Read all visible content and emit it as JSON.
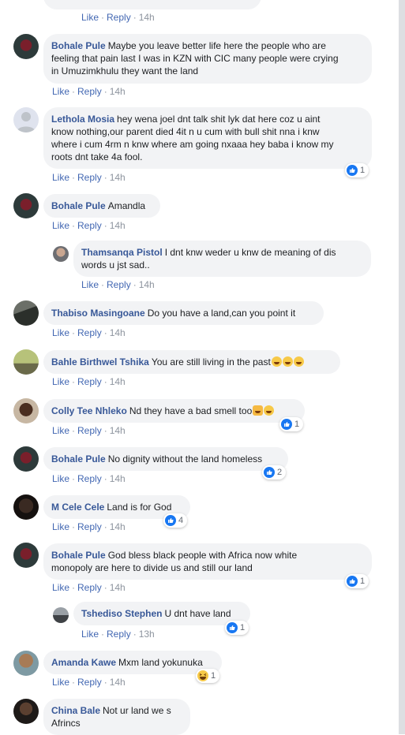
{
  "actions": {
    "like": "Like",
    "reply": "Reply",
    "sep": "·"
  },
  "top": {
    "time": "14h"
  },
  "comments": [
    {
      "name": "Bohale Pule",
      "text_line1": "Maybe you leave better life here the people who are",
      "text_line2": "feeling that pain last I was in KZN with CIC many people were crying",
      "text_line3": "in Umuzimkhulu they want the land",
      "time": "14h"
    },
    {
      "name": "Lethola Mosia",
      "text_line1": "hey wena joel dnt talk shit lyk dat here coz u aint",
      "text_line2": "know nothing,our parent died 4it n u cum with bull shit nna i knw",
      "text_line3": "where i cum 4rm n knw where am going nxaaa hey baba i know my",
      "text_line4": "roots dnt take 4a fool.",
      "time": "14h",
      "reaction_count": "1"
    },
    {
      "name": "Bohale Pule",
      "text": "Amandla",
      "time": "14h"
    },
    {
      "name": "Thamsanqa Pistol",
      "text_line1": "I dnt knw weder u knw de meaning of dis",
      "text_line2": "words u jst sad..",
      "time": "14h"
    },
    {
      "name": "Thabiso Masingoane",
      "text": "Do you have a land,can you point it",
      "time": "14h"
    },
    {
      "name": "Bahle Birthwel Tshika",
      "text": "You are still living in the past",
      "time": "14h"
    },
    {
      "name": "Colly Tee Nhleko",
      "text": "Nd they have a bad smell too",
      "time": "14h",
      "reaction_count": "1"
    },
    {
      "name": "Bohale Pule",
      "text": "No dignity without the land homeless",
      "time": "14h",
      "reaction_count": "2"
    },
    {
      "name": "M Cele Cele",
      "text": "Land is for God",
      "time": "14h",
      "reaction_count": "4"
    },
    {
      "name": "Bohale Pule",
      "text_line1": "God bless black people with Africa now white",
      "text_line2": "monopoly are here to divide us and still our land",
      "time": "14h",
      "reaction_count": "1"
    },
    {
      "name": "Tshediso Stephen",
      "text": "U dnt have land",
      "time": "13h",
      "reaction_count": "1"
    },
    {
      "name": "Amanda Kawe",
      "text": "Mxm land yokunuka",
      "time": "14h",
      "reaction_count": "1"
    },
    {
      "name": "China Bale",
      "text_line1": "Not ur land we s",
      "text_line2": "Afrincs"
    }
  ],
  "colors": {
    "link": "#385898",
    "action": "#4267b2",
    "bubble": "#f2f3f5",
    "like": "#1877f2"
  },
  "icons": {
    "like": "like-icon",
    "haha": "haha-icon"
  }
}
